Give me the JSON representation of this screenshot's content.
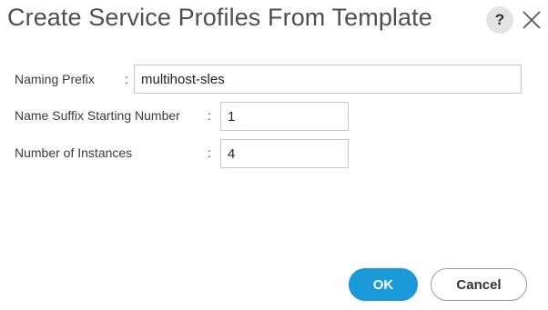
{
  "dialog": {
    "title": "Create Service Profiles From Template",
    "help_icon_glyph": "?",
    "help_icon": "question-mark-icon",
    "close_icon": "close-x-icon"
  },
  "form": {
    "fields": [
      {
        "label": "Naming Prefix",
        "colon": ":",
        "value": "multihost-sles"
      },
      {
        "label": "Name Suffix Starting Number",
        "colon": ":",
        "value": "1"
      },
      {
        "label": "Number of Instances",
        "colon": ":",
        "value": "4"
      }
    ]
  },
  "buttons": {
    "ok_label": "OK",
    "cancel_label": "Cancel"
  },
  "colors": {
    "ok_button": "#1a9ad9",
    "title_text": "#4f4f4f",
    "input_border": "#c8c8c8"
  }
}
